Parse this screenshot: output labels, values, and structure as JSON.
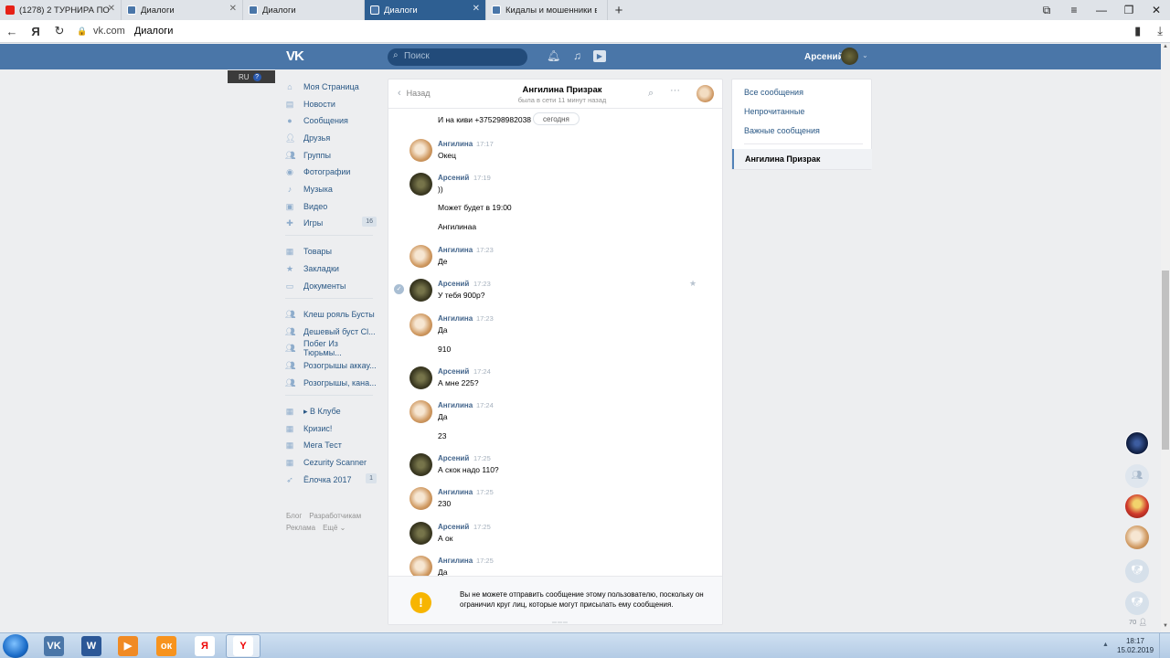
{
  "browser": {
    "tabs": [
      {
        "label": "(1278) 2 ТУРНИРА ПО",
        "favicon": "youtube-icon",
        "active": false
      },
      {
        "label": "Диалоги",
        "favicon": "vk-icon",
        "active": false
      },
      {
        "label": "Диалоги",
        "favicon": "vk-icon",
        "active": false
      },
      {
        "label": "Диалоги",
        "favicon": "vk-icon",
        "active": true
      },
      {
        "label": "Кидалы и мошенники в vk",
        "favicon": "vk-icon",
        "active": false
      }
    ],
    "address": {
      "host": "vk.com",
      "page_title": "Диалоги"
    }
  },
  "vk_header": {
    "logo": "VK",
    "search_placeholder": "Поиск",
    "user_name": "Арсений"
  },
  "lang_widget": {
    "label": "RU",
    "help": "?"
  },
  "left_menu": {
    "items": [
      {
        "label": "Моя Страница",
        "icon": "home-icon",
        "count": ""
      },
      {
        "label": "Новости",
        "icon": "news-icon",
        "count": ""
      },
      {
        "label": "Сообщения",
        "icon": "messages-icon",
        "count": ""
      },
      {
        "label": "Друзья",
        "icon": "friends-icon",
        "count": ""
      },
      {
        "label": "Группы",
        "icon": "groups-icon",
        "count": ""
      },
      {
        "label": "Фотографии",
        "icon": "camera-icon",
        "count": ""
      },
      {
        "label": "Музыка",
        "icon": "music-icon",
        "count": ""
      },
      {
        "label": "Видео",
        "icon": "video-icon",
        "count": ""
      },
      {
        "label": "Игры",
        "icon": "gamepad-icon",
        "count": "16"
      },
      {
        "label": "Товары",
        "icon": "shop-icon",
        "count": ""
      },
      {
        "label": "Закладки",
        "icon": "star-icon",
        "count": ""
      },
      {
        "label": "Документы",
        "icon": "document-icon",
        "count": ""
      },
      {
        "label": "Клеш рояль Бусты",
        "icon": "group-icon",
        "count": ""
      },
      {
        "label": "Дешевый буст Cl...",
        "icon": "group-icon",
        "count": ""
      },
      {
        "label": "Побег Из Тюрьмы...",
        "icon": "group-icon",
        "count": ""
      },
      {
        "label": "Розогрышы аккау...",
        "icon": "group-icon",
        "count": ""
      },
      {
        "label": "Розогрышы, кана...",
        "icon": "group-icon",
        "count": ""
      },
      {
        "label": "▸ В Клубе",
        "icon": "app-icon",
        "count": ""
      },
      {
        "label": "Кризис!",
        "icon": "app-icon",
        "count": ""
      },
      {
        "label": "Мега Тест",
        "icon": "app-icon",
        "count": ""
      },
      {
        "label": "Cezurity Scanner",
        "icon": "app-icon",
        "count": ""
      },
      {
        "label": "Ёлочка 2017",
        "icon": "rocket-icon",
        "count": "1"
      }
    ],
    "footer": [
      "Блог",
      "Разработчикам",
      "Реклама",
      "Ещё ⌄"
    ]
  },
  "chat": {
    "back_label": "Назад",
    "peer_name": "Ангилина Призрак",
    "peer_status": "была в сети 11 минут назад",
    "date_divider": "сегодня",
    "first_text": "И на киви +375298982038",
    "messages": [
      {
        "author": "Ангилина",
        "time": "17:17",
        "lines": [
          "Окец"
        ]
      },
      {
        "author": "Арсений",
        "time": "17:19",
        "lines": [
          "))",
          "Может будет в 19:00",
          "Ангилинаа"
        ]
      },
      {
        "author": "Ангилина",
        "time": "17:23",
        "lines": [
          "Де"
        ]
      },
      {
        "author": "Арсений",
        "time": "17:23",
        "lines": [
          "У тебя 900р?"
        ]
      },
      {
        "author": "Ангилина",
        "time": "17:23",
        "lines": [
          "Да",
          "910"
        ]
      },
      {
        "author": "Арсений",
        "time": "17:24",
        "lines": [
          "А мне 225?"
        ]
      },
      {
        "author": "Ангилина",
        "time": "17:24",
        "lines": [
          "Да",
          "23"
        ]
      },
      {
        "author": "Арсений",
        "time": "17:25",
        "lines": [
          "А скок надо 110?"
        ]
      },
      {
        "author": "Ангилина",
        "time": "17:25",
        "lines": [
          "230"
        ]
      },
      {
        "author": "Арсений",
        "time": "17:25",
        "lines": [
          "А ок"
        ]
      },
      {
        "author": "Ангилина",
        "time": "17:25",
        "lines": [
          "Да"
        ]
      }
    ],
    "banner": "Вы не можете отправить сообщение этому пользователю, поскольку он ограничил круг лиц, которые могут присылать ему сообщения."
  },
  "right_panel": {
    "filters": [
      "Все сообщения",
      "Непрочитанные",
      "Важные сообщения"
    ],
    "active_conversation": "Ангилина Призрак"
  },
  "dock": {
    "online_count": "70"
  },
  "taskbar": {
    "time": "18:17",
    "date": "15.02.2019"
  },
  "colors": {
    "vk_blue": "#4a76a8",
    "link": "#2a5885",
    "author": "#42648b",
    "warning": "#f7b500"
  }
}
